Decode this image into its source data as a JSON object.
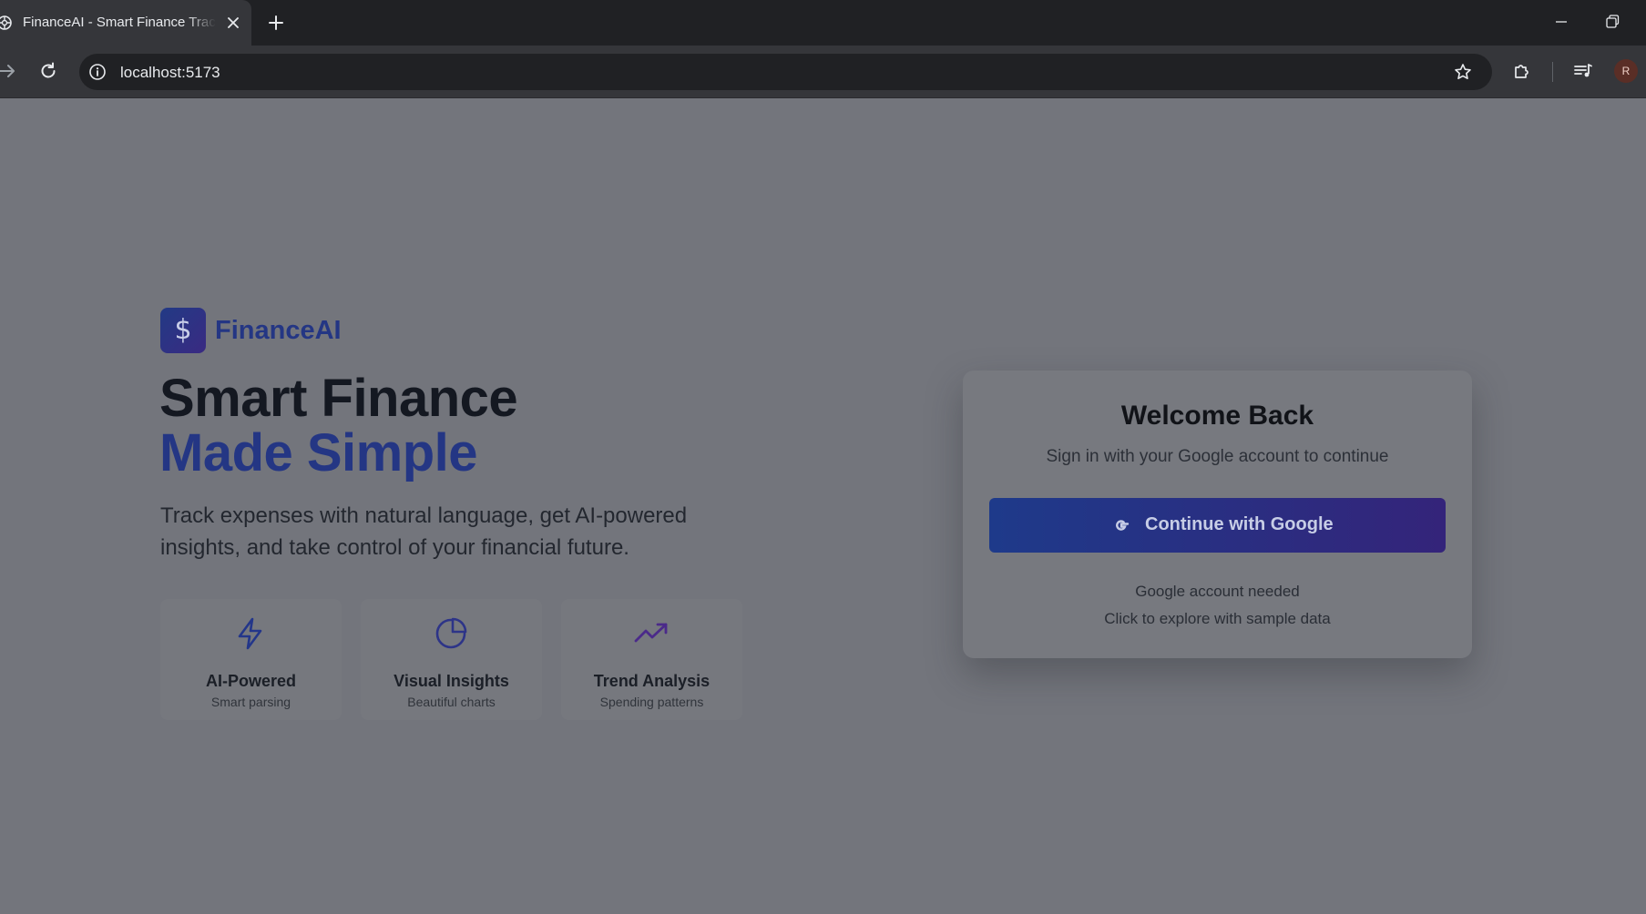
{
  "browser": {
    "tab_title": "FinanceAI - Smart Finance Tracker",
    "url": "localhost:5173",
    "avatar_initial": "R"
  },
  "brand": {
    "logo_symbol": "$",
    "name": "FinanceAI"
  },
  "hero": {
    "line1": "Smart Finance",
    "line2": "Made Simple",
    "description": "Track expenses with natural language, get AI-powered insights, and take control of your financial future."
  },
  "features": [
    {
      "icon": "lightning-icon",
      "title": "AI-Powered",
      "subtitle": "Smart parsing"
    },
    {
      "icon": "pie-chart-icon",
      "title": "Visual Insights",
      "subtitle": "Beautiful charts"
    },
    {
      "icon": "trending-up-icon",
      "title": "Trend Analysis",
      "subtitle": "Spending patterns"
    }
  ],
  "login_card": {
    "title": "Welcome Back",
    "subtitle": "Sign in with your Google account to continue",
    "google_button_label": "Continue with Google",
    "note_line1": "Google account needed",
    "note_line2": "Click to explore with sample data"
  },
  "colors": {
    "overlay_background": "#73757c",
    "brand_blue": "#243684",
    "button_gradient_start": "#1e3a8a",
    "button_gradient_end": "#34247a",
    "trend_icon_purple": "#4b2a8a"
  }
}
